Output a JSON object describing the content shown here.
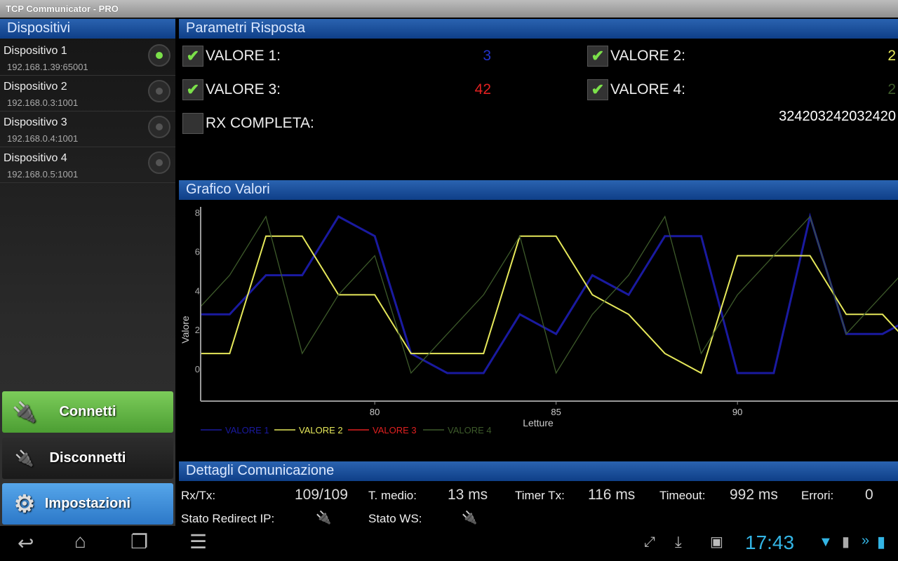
{
  "title": "TCP Communicator - PRO",
  "sidebar": {
    "header": "Dispositivi",
    "devices": [
      {
        "name": "Dispositivo 1",
        "address": "192.168.1.39:65001",
        "selected": true
      },
      {
        "name": "Dispositivo 2",
        "address": "192.168.0.3:1001",
        "selected": false
      },
      {
        "name": "Dispositivo 3",
        "address": "192.168.0.4:1001",
        "selected": false
      },
      {
        "name": "Dispositivo 4",
        "address": "192.168.0.5:1001",
        "selected": false
      }
    ],
    "buttons": {
      "connect": "Connetti",
      "disconnect": "Disconnetti",
      "settings": "Impostazioni"
    }
  },
  "params": {
    "header": "Parametri Risposta",
    "v1": {
      "label": "VALORE 1:",
      "value": "3",
      "checked": true,
      "color": "#2233cc"
    },
    "v2": {
      "label": "VALORE 2:",
      "value": "2",
      "checked": true,
      "color": "#e6e85a"
    },
    "v3": {
      "label": "VALORE 3:",
      "value": "42",
      "checked": true,
      "color": "#e02020"
    },
    "v4": {
      "label": "VALORE 4:",
      "value": "2",
      "checked": true,
      "color": "#3d5a2a"
    },
    "rx": {
      "label": "RX COMPLETA:",
      "value": "324203242032420",
      "checked": false
    }
  },
  "chart_header": "Grafico Valori",
  "chart_data": {
    "type": "line",
    "xlabel": "Letture",
    "ylabel": "Valore",
    "xlim": [
      75.2,
      94.6
    ],
    "ylim": [
      -1.6,
      8.5
    ],
    "xticks": [
      80,
      85,
      90
    ],
    "yticks": [
      0,
      2,
      4,
      6,
      8
    ],
    "grid": false,
    "legend": "bottom-left",
    "x": [
      75,
      76,
      77,
      78,
      79,
      80,
      81,
      82,
      83,
      84,
      85,
      86,
      87,
      88,
      89,
      90,
      91,
      92,
      93,
      94,
      95
    ],
    "series": [
      {
        "name": "VALORE 1",
        "color": "#1a1aa0",
        "values": [
          3,
          3,
          5,
          5,
          8,
          7,
          1,
          0,
          0,
          3,
          2,
          5,
          4,
          7,
          7,
          0,
          0,
          8,
          2,
          2,
          3
        ]
      },
      {
        "name": "VALORE 2",
        "color": "#e6e85a",
        "values": [
          1,
          1,
          7,
          7,
          4,
          4,
          1,
          1,
          1,
          7,
          7,
          4,
          3,
          1,
          0,
          6,
          6,
          6,
          3,
          3,
          1
        ]
      },
      {
        "name": "VALORE 3",
        "color": "#e02020",
        "values": []
      },
      {
        "name": "VALORE 4",
        "color": "#3d5a2a",
        "values": [
          3,
          5,
          8,
          1,
          4,
          6,
          0,
          2,
          4,
          7,
          0,
          3,
          5,
          8,
          1,
          4,
          6,
          8,
          2,
          4,
          6
        ]
      }
    ]
  },
  "details": {
    "header": "Dettagli Comunicazione",
    "rxtx_label": "Rx/Tx:",
    "rxtx": "109/109",
    "tmedio_label": "T. medio:",
    "tmedio": "13 ms",
    "timer_label": "Timer Tx:",
    "timer": "116 ms",
    "timeout_label": "Timeout:",
    "timeout": "992 ms",
    "errors_label": "Errori:",
    "errors": "0",
    "redirect_label": "Stato Redirect IP:",
    "ws_label": "Stato WS:"
  },
  "statusbar": {
    "time": "17:43"
  }
}
